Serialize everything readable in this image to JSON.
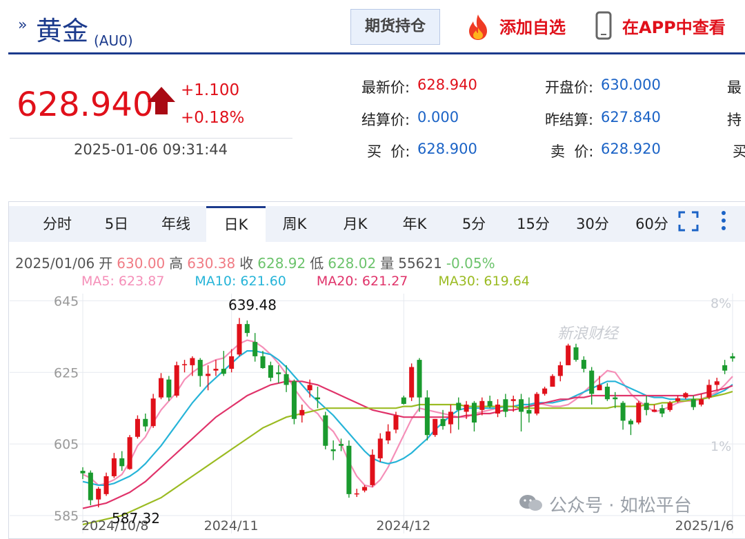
{
  "header": {
    "title_arrow": "»",
    "title": "黄金",
    "code": "(AU0)",
    "btn_position": "期货持仓",
    "btn_add_fav": "添加自选",
    "btn_app": "在APP中查看"
  },
  "quote": {
    "price": "628.940",
    "change": "+1.100",
    "change_pct": "+0.18%",
    "time": "2025-01-06 09:31:44",
    "fields": [
      {
        "label": "最新价:",
        "value": "628.940",
        "red": true
      },
      {
        "label": "开盘价:",
        "value": "630.000",
        "red": false
      },
      {
        "label": "结算价:",
        "value": "0.000",
        "red": false
      },
      {
        "label": "昨结算:",
        "value": "627.840",
        "red": false
      },
      {
        "label": "买  价:",
        "value": "628.900",
        "red": false
      },
      {
        "label": "卖  价:",
        "value": "628.920",
        "red": false
      }
    ],
    "cut_labels": [
      "最",
      "持",
      "买"
    ]
  },
  "tabs": [
    "分时",
    "5日",
    "年线",
    "日K",
    "周K",
    "月K",
    "年K",
    "5分",
    "15分",
    "30分",
    "60分"
  ],
  "active_tab": "日K",
  "info_bar": {
    "date": "2025/01/06",
    "open_label": "开",
    "open": "630.00",
    "high_label": "高",
    "high": "630.38",
    "close_label": "收",
    "close": "628.92",
    "low_label": "低",
    "low": "628.02",
    "vol_label": "量",
    "vol": "55621",
    "pct": "-0.05%"
  },
  "ma_legend": [
    {
      "text": "MA5: 623.87",
      "color": "#f58fb8"
    },
    {
      "text": "MA10: 621.60",
      "color": "#26b4d8"
    },
    {
      "text": "MA20: 621.27",
      "color": "#e0336a"
    },
    {
      "text": "MA30: 619.64",
      "color": "#9bbb22"
    }
  ],
  "watermark": {
    "sina": "新浪财经",
    "wechat": "公众号 · 如松平台"
  },
  "colors": {
    "up": "#e0101a",
    "down": "#1a9a2e",
    "accent": "#1b3a8c",
    "link": "#1b63c6"
  },
  "chart_data": {
    "type": "candlestick",
    "y_ticks": [
      "645",
      "625",
      "605",
      "585"
    ],
    "right_ticks": [
      "8%",
      "",
      "1%",
      ""
    ],
    "x_labels": [
      "2024/10/8",
      "2024/11",
      "2024/12",
      "2025/1/6"
    ],
    "annotations": [
      "639.48",
      "587.32"
    ],
    "ylim": [
      580,
      647
    ],
    "candles": [
      [
        597.5,
        598.5,
        595.2,
        596.8
      ],
      [
        597.0,
        597.6,
        587.9,
        589.3
      ],
      [
        589.5,
        593.0,
        587.3,
        592.5
      ],
      [
        591.0,
        597.0,
        590.5,
        596.0
      ],
      [
        596.0,
        602.5,
        595.5,
        601.0
      ],
      [
        601.0,
        603.0,
        597.5,
        598.8
      ],
      [
        598.0,
        607.5,
        597.8,
        606.9
      ],
      [
        607.0,
        613.0,
        606.5,
        612.0
      ],
      [
        612.0,
        613.5,
        608.5,
        609.9
      ],
      [
        610.0,
        619.0,
        609.5,
        617.7
      ],
      [
        618.0,
        624.8,
        617.5,
        623.4
      ],
      [
        623.0,
        624.0,
        617.0,
        618.0
      ],
      [
        618.5,
        628.0,
        618.0,
        627.0
      ],
      [
        627.0,
        628.5,
        625.0,
        627.3
      ],
      [
        627.0,
        629.5,
        624.0,
        629.0
      ],
      [
        628.5,
        629.0,
        621.0,
        624.0
      ],
      [
        624.0,
        627.0,
        620.0,
        624.6
      ],
      [
        625.5,
        628.5,
        624.0,
        626.0
      ],
      [
        626.0,
        631.0,
        624.0,
        624.6
      ],
      [
        626.0,
        631.5,
        625.0,
        629.5
      ],
      [
        630.0,
        640.2,
        629.5,
        638.5
      ],
      [
        638.5,
        639.5,
        635.0,
        636.0
      ],
      [
        633.5,
        636.0,
        628.0,
        629.5
      ],
      [
        629.5,
        631.0,
        626.0,
        626.2
      ],
      [
        627.0,
        628.0,
        622.5,
        623.5
      ],
      [
        625.0,
        627.0,
        622.0,
        624.5
      ],
      [
        624.5,
        627.0,
        619.5,
        621.5
      ],
      [
        622.5,
        623.0,
        610.5,
        612.0
      ],
      [
        613.0,
        616.0,
        611.0,
        614.5
      ],
      [
        620.0,
        623.0,
        618.0,
        621.5
      ],
      [
        618.0,
        621.0,
        615.0,
        617.5
      ],
      [
        613.0,
        614.0,
        603.5,
        604.5
      ],
      [
        603.5,
        606.0,
        600.5,
        603.0
      ],
      [
        605.0,
        606.5,
        603.0,
        604.5
      ],
      [
        604.5,
        606.0,
        590.0,
        591.0
      ],
      [
        591.0,
        592.5,
        590.2,
        591.2
      ],
      [
        592.0,
        593.5,
        591.5,
        593.0
      ],
      [
        593.5,
        603.5,
        593.0,
        602.0
      ],
      [
        601.0,
        608.0,
        600.0,
        606.5
      ],
      [
        606.0,
        610.5,
        605.0,
        608.5
      ],
      [
        609.0,
        614.0,
        608.0,
        613.0
      ],
      [
        618.0,
        618.5,
        616.0,
        616.2
      ],
      [
        618.0,
        627.5,
        617.0,
        626.5
      ],
      [
        628.5,
        629.0,
        614.0,
        618.0
      ],
      [
        618.0,
        620.0,
        606.0,
        607.5
      ],
      [
        607.5,
        612.0,
        607.0,
        612.0
      ],
      [
        612.0,
        614.5,
        609.0,
        610.0
      ],
      [
        610.5,
        616.0,
        608.0,
        614.0
      ],
      [
        616.5,
        618.0,
        609.0,
        614.5
      ],
      [
        614.0,
        617.0,
        612.0,
        616.0
      ],
      [
        616.5,
        617.0,
        608.5,
        611.0
      ],
      [
        614.5,
        618.0,
        613.0,
        617.0
      ],
      [
        617.0,
        618.5,
        615.0,
        615.5
      ],
      [
        613.5,
        617.5,
        612.5,
        616.0
      ],
      [
        617.5,
        619.0,
        612.5,
        614.0
      ],
      [
        617.0,
        618.5,
        614.0,
        617.5
      ],
      [
        617.5,
        619.0,
        608.5,
        614.0
      ],
      [
        614.5,
        618.0,
        611.0,
        613.5
      ],
      [
        613.5,
        619.5,
        613.0,
        619.0
      ],
      [
        619.0,
        621.0,
        618.5,
        620.5
      ],
      [
        621.0,
        624.5,
        621.0,
        624.0
      ],
      [
        624.0,
        628.0,
        622.5,
        627.0
      ],
      [
        627.0,
        633.0,
        627.0,
        632.5
      ],
      [
        632.0,
        633.0,
        628.0,
        628.5
      ],
      [
        628.5,
        629.5,
        625.0,
        626.0
      ],
      [
        625.5,
        626.5,
        616.0,
        619.0
      ],
      [
        620.0,
        624.0,
        620.0,
        621.5
      ],
      [
        621.0,
        622.0,
        617.0,
        617.5
      ],
      [
        618.0,
        619.5,
        615.0,
        617.5
      ],
      [
        616.5,
        617.0,
        609.0,
        611.5
      ],
      [
        611.5,
        612.0,
        607.5,
        610.5
      ],
      [
        611.0,
        617.0,
        610.5,
        616.5
      ],
      [
        616.5,
        618.5,
        613.0,
        614.5
      ],
      [
        614.0,
        616.0,
        614.0,
        614.6
      ],
      [
        615.0,
        616.0,
        612.5,
        613.5
      ],
      [
        614.5,
        617.0,
        614.0,
        616.5
      ],
      [
        617.0,
        618.5,
        616.5,
        617.8
      ],
      [
        618.0,
        619.5,
        617.5,
        619.2
      ],
      [
        617.5,
        618.5,
        614.5,
        615.3
      ],
      [
        616.0,
        619.0,
        615.5,
        617.5
      ],
      [
        618.0,
        623.0,
        617.5,
        621.5
      ],
      [
        621.5,
        623.5,
        620.0,
        622.5
      ],
      [
        627.0,
        628.5,
        624.5,
        625.5
      ],
      [
        629.5,
        630.4,
        628.0,
        628.9
      ]
    ],
    "series": [
      {
        "name": "MA5",
        "values": [
          596.5,
          595.5,
          593.5,
          594.0,
          595.0,
          596.5,
          600.0,
          604.5,
          607.0,
          611.0,
          614.5,
          617.0,
          619.5,
          623.0,
          625.0,
          626.5,
          627.5,
          628.5,
          629.0,
          631.0,
          633.0,
          634.0,
          633.5,
          632.0,
          630.0,
          627.5,
          624.5,
          620.5,
          617.5,
          615.0,
          613.5,
          610.5,
          608.5,
          605.0,
          600.0,
          596.0,
          593.5,
          593.0,
          595.0,
          598.5,
          603.0,
          607.5,
          612.0,
          615.0,
          614.5,
          614.0,
          613.5,
          613.0,
          612.5,
          612.5,
          613.5,
          614.0,
          614.5,
          615.0,
          615.5,
          615.5,
          616.0,
          616.0,
          616.5,
          616.0,
          615.5,
          615.5,
          616.0,
          617.5,
          619.5,
          621.5,
          623.5,
          625.5,
          625.0,
          622.0,
          619.0,
          617.0,
          615.5,
          614.0,
          614.5,
          615.5,
          616.5,
          617.0,
          617.0,
          617.5,
          618.5,
          619.5,
          621.5,
          623.87
        ]
      },
      {
        "name": "MA10",
        "values": [
          594.5,
          594.0,
          593.5,
          593.5,
          594.0,
          595.0,
          596.0,
          597.5,
          599.5,
          602.0,
          604.5,
          607.5,
          610.5,
          613.5,
          616.5,
          619.0,
          621.5,
          623.5,
          625.5,
          627.5,
          629.5,
          631.0,
          631.0,
          630.5,
          630.0,
          628.5,
          626.5,
          624.0,
          621.5,
          619.0,
          617.0,
          615.0,
          613.0,
          610.5,
          608.0,
          605.5,
          603.0,
          601.0,
          600.0,
          599.5,
          600.0,
          601.0,
          602.5,
          604.5,
          606.5,
          609.0,
          611.0,
          613.0,
          614.5,
          615.0,
          615.0,
          615.0,
          615.0,
          615.0,
          615.5,
          615.5,
          616.0,
          616.0,
          616.5,
          616.5,
          616.5,
          617.0,
          617.5,
          618.5,
          619.5,
          620.5,
          621.5,
          622.5,
          622.5,
          621.5,
          620.5,
          619.5,
          618.5,
          618.0,
          618.0,
          617.5,
          617.5,
          617.5,
          617.5,
          617.5,
          618.0,
          619.0,
          620.0,
          621.6
        ]
      },
      {
        "name": "MA20",
        "values": [
          587.0,
          587.5,
          588.0,
          588.5,
          589.5,
          590.5,
          591.5,
          593.0,
          594.5,
          596.5,
          598.5,
          600.5,
          602.5,
          604.5,
          606.5,
          608.5,
          610.5,
          612.5,
          614.0,
          615.5,
          617.0,
          618.5,
          619.5,
          620.5,
          621.5,
          622.0,
          622.5,
          622.5,
          622.5,
          622.0,
          621.5,
          620.5,
          619.5,
          618.5,
          617.5,
          616.5,
          615.5,
          614.5,
          614.0,
          613.5,
          613.0,
          612.5,
          612.5,
          612.5,
          612.5,
          612.5,
          612.5,
          612.5,
          612.5,
          613.0,
          613.0,
          613.5,
          613.5,
          614.0,
          614.5,
          614.5,
          615.0,
          615.5,
          616.0,
          616.5,
          617.0,
          617.5,
          617.5,
          618.0,
          618.0,
          618.5,
          618.5,
          618.5,
          618.5,
          618.5,
          618.5,
          618.5,
          618.5,
          618.5,
          618.5,
          618.5,
          618.5,
          618.5,
          618.5,
          619.0,
          619.5,
          620.0,
          620.5,
          621.27
        ]
      },
      {
        "name": "MA30",
        "values": [
          582.5,
          583.0,
          583.5,
          584.0,
          584.5,
          585.0,
          586.0,
          587.0,
          588.0,
          589.0,
          590.0,
          591.5,
          593.0,
          594.5,
          596.0,
          597.5,
          599.0,
          600.5,
          602.0,
          603.5,
          605.0,
          606.5,
          608.0,
          609.5,
          610.5,
          611.5,
          612.5,
          613.0,
          613.5,
          614.0,
          614.5,
          615.0,
          615.0,
          615.0,
          615.0,
          615.0,
          615.0,
          615.0,
          615.0,
          615.0,
          615.0,
          615.5,
          615.5,
          616.0,
          616.0,
          616.0,
          616.0,
          616.0,
          616.0,
          615.5,
          615.5,
          615.5,
          615.5,
          615.5,
          615.5,
          615.5,
          615.0,
          615.0,
          615.0,
          615.0,
          615.0,
          615.0,
          615.0,
          615.0,
          615.0,
          615.0,
          615.0,
          615.0,
          615.5,
          615.5,
          615.5,
          615.5,
          616.0,
          616.0,
          616.5,
          616.5,
          617.0,
          617.0,
          617.5,
          617.5,
          618.0,
          618.5,
          619.0,
          619.64
        ]
      }
    ]
  }
}
